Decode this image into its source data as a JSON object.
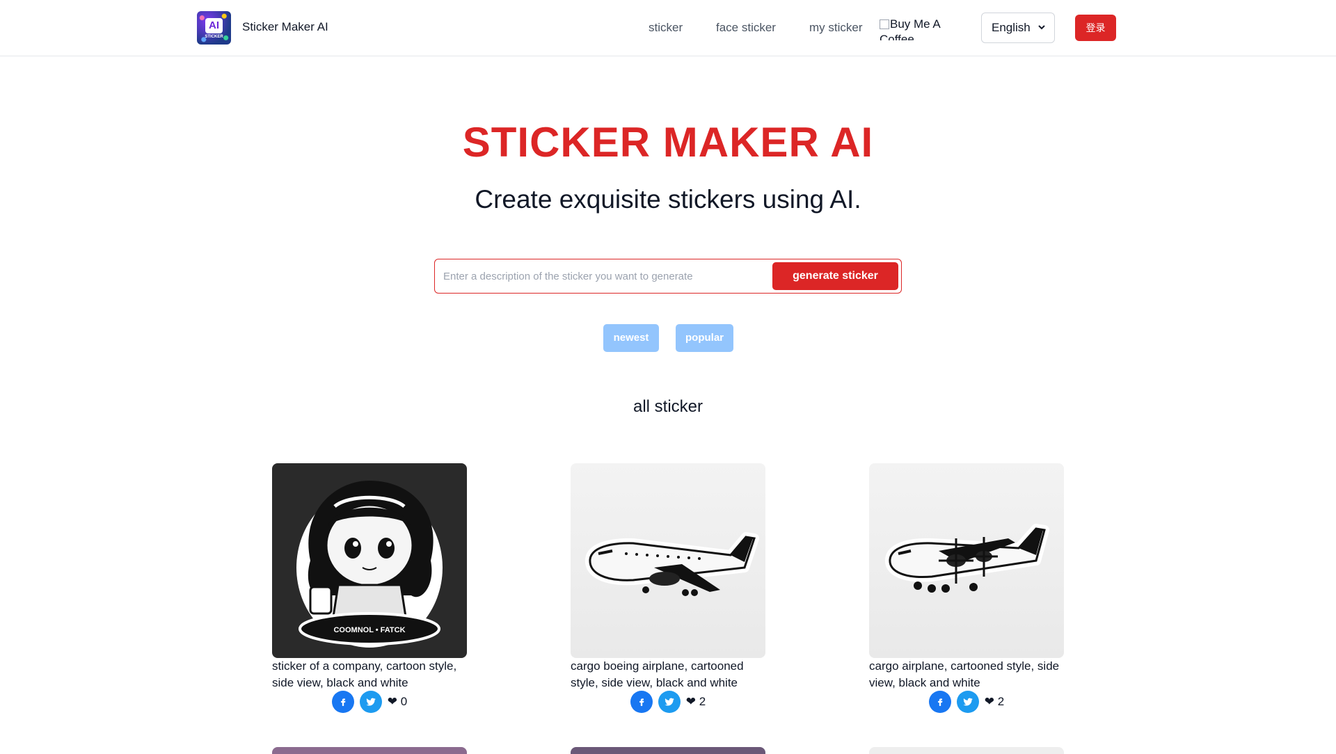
{
  "header": {
    "brand": "Sticker Maker AI",
    "logo_text": "AI",
    "logo_subtext": "STICKER",
    "nav": [
      "sticker",
      "face sticker",
      "my sticker"
    ],
    "coffee_alt": "Buy Me A Coffee",
    "language": "English",
    "login_label": "登录"
  },
  "hero": {
    "title": "STICKER MAKER AI",
    "subtitle": "Create exquisite stickers using AI.",
    "search_placeholder": "Enter a description of the sticker you want to generate",
    "generate_label": "generate sticker",
    "filters": [
      "newest",
      "popular"
    ]
  },
  "section_title": "all sticker",
  "stickers": [
    {
      "description": "sticker of a company, cartoon style, side view, black and white",
      "likes": "❤ 0",
      "image": "cartoon-girl-sticker",
      "badge_text": "COOMNOL • FATCK"
    },
    {
      "description": "cargo boeing airplane, cartooned style, side view, black and white",
      "likes": "❤ 2",
      "image": "boeing-airplane-sticker"
    },
    {
      "description": "cargo airplane, cartooned style, side view, black and white",
      "likes": "❤ 2",
      "image": "propeller-airplane-sticker"
    }
  ],
  "colors": {
    "accent": "#dc2626",
    "pill": "#93c5fd",
    "facebook": "#1877f2",
    "twitter": "#1d9bf0"
  }
}
